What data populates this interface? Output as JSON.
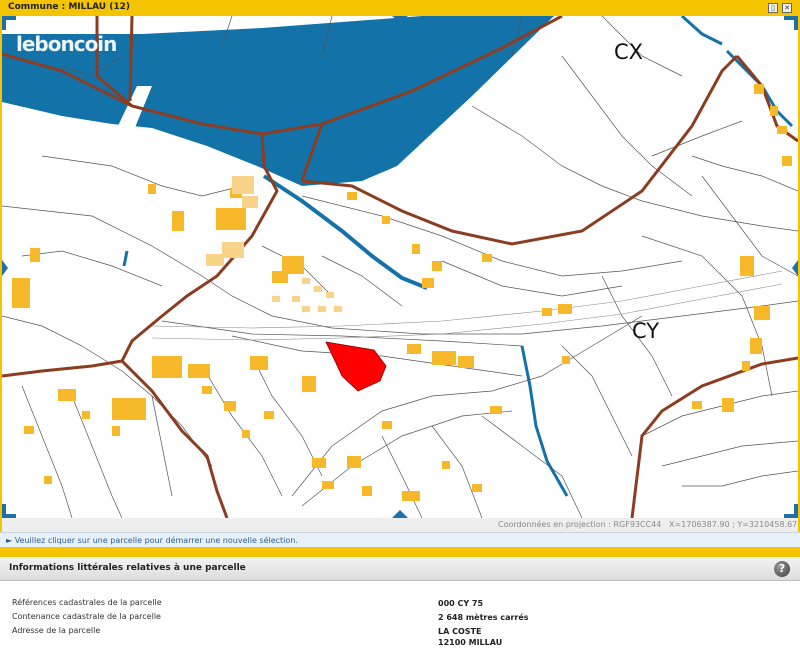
{
  "window": {
    "title": "Commune : MILLAU (12)",
    "restore_label": "▯",
    "close_label": "✕"
  },
  "map": {
    "watermark": "leboncoin",
    "section_labels": [
      "CX",
      "CY"
    ],
    "colors": {
      "river": "#1372a8",
      "boundary": "#8c3c20",
      "building": "#f7b92a",
      "building_light": "#fad38a",
      "selected_parcel": "#ff0000",
      "stream": "#1372a8"
    }
  },
  "coordinates": {
    "projection_label": "Coordonnées en projection : RGF93CC44",
    "xy_text": "X=1706387.90 ; Y=3210458.67"
  },
  "info_message": "► Veuillez cliquer sur une parcelle pour démarrer une nouvelle sélection.",
  "panel": {
    "title": "Informations littérales relatives à une parcelle",
    "help_label": "?",
    "rows": [
      {
        "label": "Références cadastrales de la parcelle",
        "value": "000 CY 75"
      },
      {
        "label": "Contenance cadastrale de la parcelle",
        "value": "2 648 mètres carrés"
      },
      {
        "label": "Adresse de la parcelle",
        "value": "LA COSTE",
        "value2": "12100 MILLAU"
      }
    ]
  }
}
